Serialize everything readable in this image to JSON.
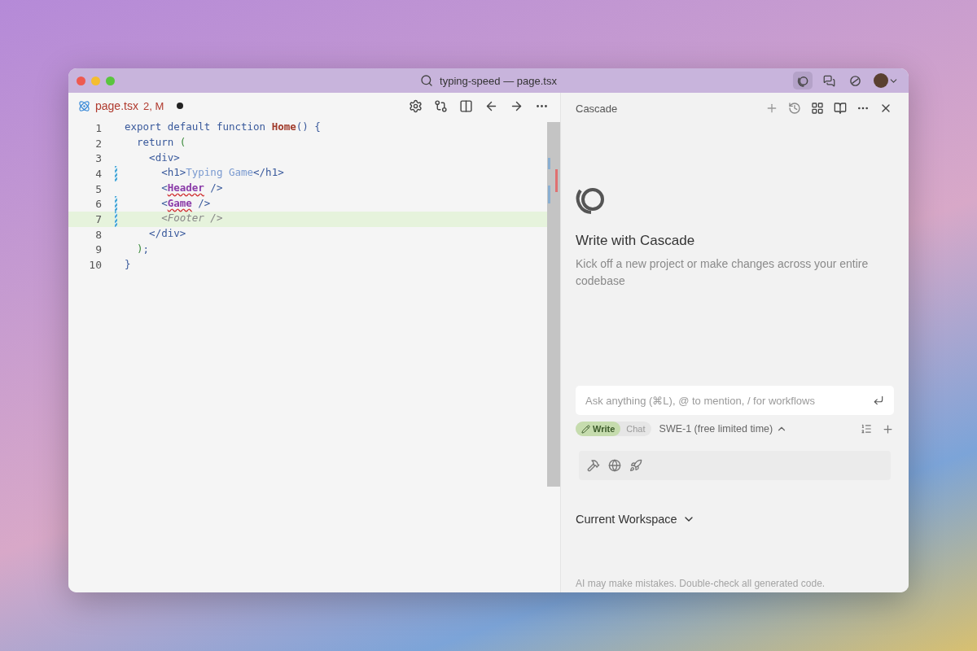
{
  "window": {
    "title": "typing-speed — page.tsx"
  },
  "editor": {
    "tab": {
      "filename": "page.tsx",
      "status": "2, M",
      "unsaved": true
    },
    "lines": [
      {
        "number": "1",
        "modified": false,
        "highlighted": false,
        "tokens": [
          {
            "text": "export default function ",
            "kind": "keyword"
          },
          {
            "text": "Home",
            "kind": "function"
          },
          {
            "text": "() {",
            "kind": "punct"
          }
        ]
      },
      {
        "number": "2",
        "modified": false,
        "highlighted": false,
        "tokens": [
          {
            "text": "  return ",
            "kind": "keyword"
          },
          {
            "text": "(",
            "kind": "bracket"
          }
        ]
      },
      {
        "number": "3",
        "modified": false,
        "highlighted": false,
        "tokens": [
          {
            "text": "    <div>",
            "kind": "tag"
          }
        ]
      },
      {
        "number": "4",
        "modified": true,
        "highlighted": false,
        "tokens": [
          {
            "text": "      <h1>",
            "kind": "tag"
          },
          {
            "text": "Typing Game",
            "kind": "string"
          },
          {
            "text": "</h1>",
            "kind": "tag"
          }
        ]
      },
      {
        "number": "5",
        "modified": false,
        "highlighted": false,
        "tokens": [
          {
            "text": "      <",
            "kind": "tag"
          },
          {
            "text": "Header",
            "kind": "component",
            "error": true
          },
          {
            "text": " />",
            "kind": "tag"
          }
        ]
      },
      {
        "number": "6",
        "modified": true,
        "highlighted": false,
        "tokens": [
          {
            "text": "      <",
            "kind": "tag"
          },
          {
            "text": "Game",
            "kind": "component",
            "error": true
          },
          {
            "text": " />",
            "kind": "tag"
          }
        ]
      },
      {
        "number": "7",
        "modified": true,
        "highlighted": true,
        "tokens": [
          {
            "text": "      <Footer />",
            "kind": "ghost"
          }
        ]
      },
      {
        "number": "8",
        "modified": false,
        "highlighted": false,
        "tokens": [
          {
            "text": "    </div>",
            "kind": "tag"
          }
        ]
      },
      {
        "number": "9",
        "modified": false,
        "highlighted": false,
        "tokens": [
          {
            "text": "  )",
            "kind": "bracket"
          },
          {
            "text": ";",
            "kind": "punct"
          }
        ]
      },
      {
        "number": "10",
        "modified": false,
        "highlighted": false,
        "tokens": [
          {
            "text": "}",
            "kind": "punct"
          }
        ]
      }
    ]
  },
  "cascade": {
    "title": "Cascade",
    "heading": "Write with Cascade",
    "description": "Kick off a new project or make changes across your entire codebase",
    "input": {
      "placeholder": "Ask anything (⌘L), @ to mention, / for workflows"
    },
    "modes": [
      {
        "label": "Write",
        "selected": true
      },
      {
        "label": "Chat",
        "selected": false
      }
    ],
    "model": "SWE-1 (free limited time)",
    "workspace": "Current Workspace",
    "disclaimer": "AI may make mistakes. Double-check all generated code."
  }
}
